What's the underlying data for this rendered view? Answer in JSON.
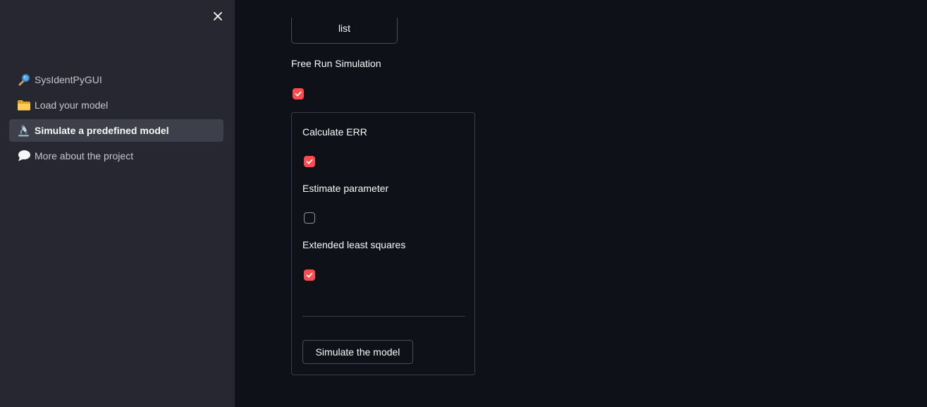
{
  "sidebar": {
    "close_icon": "close-icon",
    "items": [
      {
        "label": "SysIdentPyGUI",
        "icon": "magnifier-icon",
        "active": false
      },
      {
        "label": "Load your model",
        "icon": "folder-icon",
        "active": false
      },
      {
        "label": "Simulate a predefined model",
        "icon": "microscope-icon",
        "active": true
      },
      {
        "label": "More about the project",
        "icon": "speech-bubble-icon",
        "active": false
      }
    ]
  },
  "main": {
    "top_button_label": "list",
    "free_run": {
      "label": "Free Run Simulation",
      "checked": true
    },
    "options": [
      {
        "label": "Calculate ERR",
        "checked": true
      },
      {
        "label": "Estimate parameter",
        "checked": false
      },
      {
        "label": "Extended least squares",
        "checked": true
      }
    ],
    "simulate_button_label": "Simulate the model"
  },
  "colors": {
    "background": "#0e1117",
    "sidebar": "#262730",
    "accent": "#ff4b4b",
    "text": "#fafafa"
  }
}
